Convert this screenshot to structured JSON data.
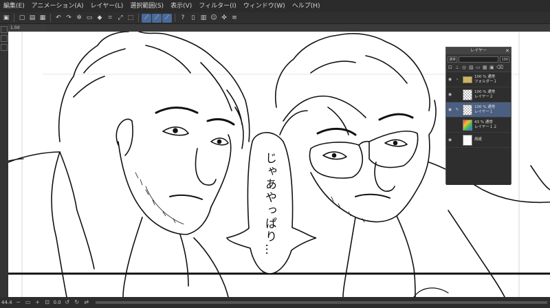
{
  "menubar": {
    "items": [
      "編集(E)",
      "アニメーション(A)",
      "レイヤー(L)",
      "選択範囲(S)",
      "表示(V)",
      "フィルター(I)",
      "ウィンドウ(W)",
      "ヘルプ(H)"
    ]
  },
  "document": {
    "tab_title": "1.0d"
  },
  "speech_bubble": {
    "text": "じゃあやっぱり…"
  },
  "status": {
    "zoom": "44.4",
    "angle": "0.0"
  },
  "layer_panel": {
    "title": "レイヤー",
    "blend_mode": "通常",
    "opacity": "100",
    "layers": [
      {
        "name": "フォルダー１",
        "info": "100 % 通常",
        "kind": "folder",
        "visible": true,
        "selected": false
      },
      {
        "name": "レイヤー２",
        "info": "100 % 通常",
        "kind": "raster",
        "visible": true,
        "selected": false
      },
      {
        "name": "レイヤー１",
        "info": "100 % 通常",
        "kind": "raster",
        "visible": true,
        "selected": true
      },
      {
        "name": "レイヤー１２",
        "info": "43 % 通常",
        "kind": "color",
        "visible": false,
        "selected": false
      },
      {
        "name": "用紙",
        "info": "",
        "kind": "paper",
        "visible": true,
        "selected": false
      }
    ]
  },
  "colors": {
    "selection": "#4b5f82",
    "menubar": "#2b2b2b",
    "panel": "#2e2e2e"
  }
}
